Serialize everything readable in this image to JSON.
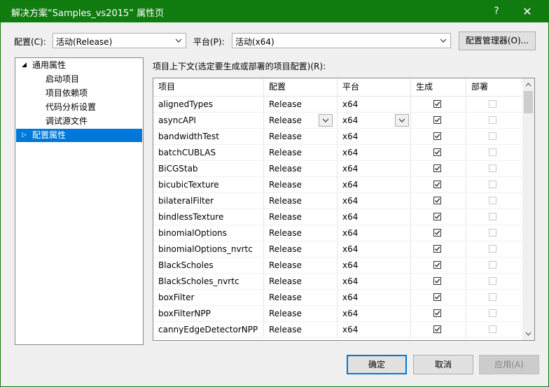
{
  "window": {
    "title": "解决方案“Samples_vs2015” 属性页",
    "help_label": "?",
    "close_label": "✕"
  },
  "toolbar": {
    "config_label": "配置(C):",
    "config_value": "活动(Release)",
    "platform_label": "平台(P):",
    "platform_value": "活动(x64)",
    "config_manager_label": "配置管理器(O)..."
  },
  "tree": {
    "items": [
      {
        "label": "通用属性",
        "toggle": "◢"
      },
      {
        "label": "启动项目"
      },
      {
        "label": "项目依赖项"
      },
      {
        "label": "代码分析设置"
      },
      {
        "label": "调试源文件"
      },
      {
        "label": "配置属性",
        "toggle": "▷"
      }
    ]
  },
  "grid": {
    "label": "项目上下文(选定要生成或部署的项目配置)(R):",
    "columns": [
      "项目",
      "配置",
      "平台",
      "生成",
      "部署"
    ],
    "rows": [
      {
        "project": "alignedTypes",
        "config": "Release",
        "platform": "x64",
        "build": true,
        "deploy": false
      },
      {
        "project": "asyncAPI",
        "config": "Release",
        "platform": "x64",
        "build": true,
        "deploy": false
      },
      {
        "project": "bandwidthTest",
        "config": "Release",
        "platform": "x64",
        "build": true,
        "deploy": false
      },
      {
        "project": "batchCUBLAS",
        "config": "Release",
        "platform": "x64",
        "build": true,
        "deploy": false
      },
      {
        "project": "BiCGStab",
        "config": "Release",
        "platform": "x64",
        "build": true,
        "deploy": false
      },
      {
        "project": "bicubicTexture",
        "config": "Release",
        "platform": "x64",
        "build": true,
        "deploy": false
      },
      {
        "project": "bilateralFilter",
        "config": "Release",
        "platform": "x64",
        "build": true,
        "deploy": false
      },
      {
        "project": "bindlessTexture",
        "config": "Release",
        "platform": "x64",
        "build": true,
        "deploy": false
      },
      {
        "project": "binomialOptions",
        "config": "Release",
        "platform": "x64",
        "build": true,
        "deploy": false
      },
      {
        "project": "binomialOptions_nvrtc",
        "config": "Release",
        "platform": "x64",
        "build": true,
        "deploy": false
      },
      {
        "project": "BlackScholes",
        "config": "Release",
        "platform": "x64",
        "build": true,
        "deploy": false
      },
      {
        "project": "BlackScholes_nvrtc",
        "config": "Release",
        "platform": "x64",
        "build": true,
        "deploy": false
      },
      {
        "project": "boxFilter",
        "config": "Release",
        "platform": "x64",
        "build": true,
        "deploy": false
      },
      {
        "project": "boxFilterNPP",
        "config": "Release",
        "platform": "x64",
        "build": true,
        "deploy": false
      },
      {
        "project": "cannyEdgeDetectorNPP",
        "config": "Release",
        "platform": "x64",
        "build": true,
        "deploy": false
      }
    ]
  },
  "footer": {
    "ok_label": "确定",
    "cancel_label": "取消",
    "apply_label": "应用(A)"
  },
  "colors": {
    "titlebar": "#107c10",
    "selection": "#0078d7"
  }
}
